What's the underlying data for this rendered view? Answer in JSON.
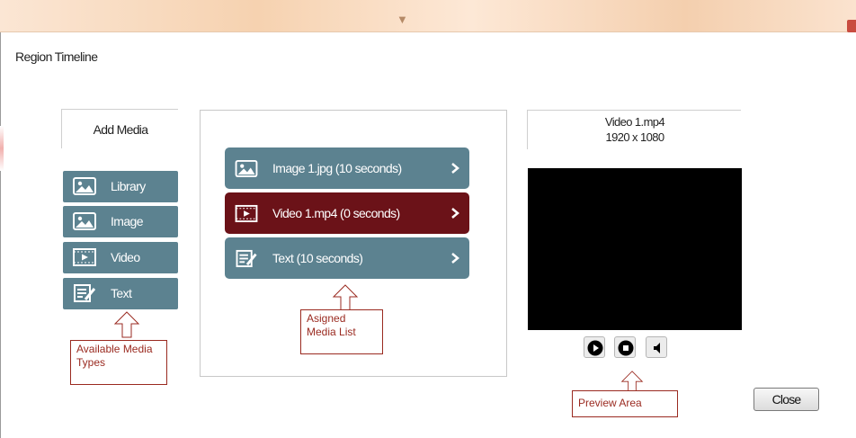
{
  "window": {
    "title": "Region Timeline",
    "close_label": "Close"
  },
  "add_media": {
    "header": "Add Media",
    "types": [
      {
        "label": "Library",
        "icon": "image-icon"
      },
      {
        "label": "Image",
        "icon": "image-icon"
      },
      {
        "label": "Video",
        "icon": "video-icon"
      },
      {
        "label": "Text",
        "icon": "text-icon"
      }
    ]
  },
  "assigned_media": {
    "items": [
      {
        "label": "Image 1.jpg (10 seconds)",
        "icon": "image-icon",
        "active": false
      },
      {
        "label": "Video 1.mp4 (0 seconds)",
        "icon": "video-icon",
        "active": true
      },
      {
        "label": "Text (10 seconds)",
        "icon": "text-icon",
        "active": false
      }
    ]
  },
  "preview": {
    "file_name": "Video 1.mp4",
    "resolution": "1920 x 1080",
    "controls": [
      "play-icon",
      "stop-icon",
      "volume-icon"
    ]
  },
  "annotations": {
    "media_types": "Available Media Types",
    "media_list": "Asigned Media List",
    "preview_area": "Preview Area"
  },
  "colors": {
    "button": "#5c8290",
    "active_item": "#6b1218",
    "callout": "#9a2a20"
  }
}
